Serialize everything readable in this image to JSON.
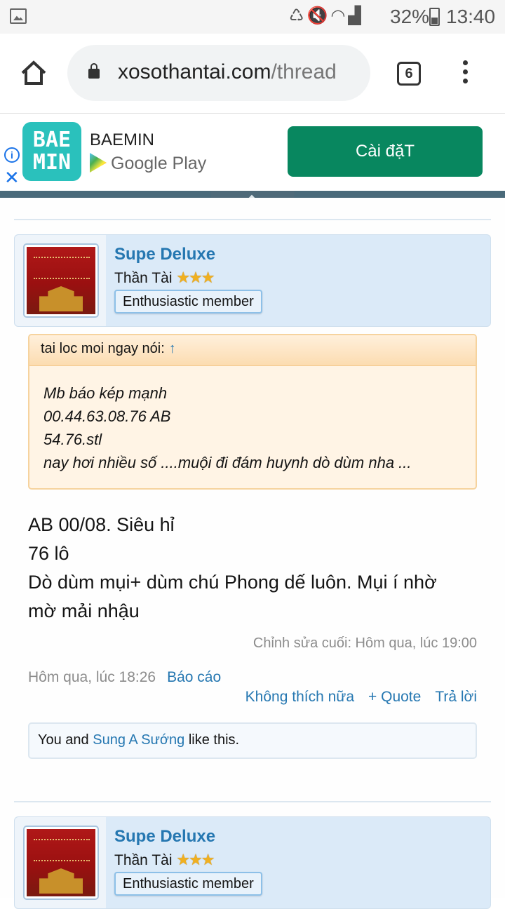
{
  "status_bar": {
    "battery": "32%",
    "time": "13:40"
  },
  "browser": {
    "url_domain": "xosothantai.com",
    "url_path": "/thread",
    "tab_count": "6"
  },
  "ad": {
    "logo_line1": "BAE",
    "logo_line2": "MIN",
    "brand": "BAEMIN",
    "store": "Google Play",
    "install_label": "Cài đặT",
    "info_glyph": "i",
    "close_glyph": "✕"
  },
  "posts": [
    {
      "username": "Supe Deluxe",
      "user_title": "Thần Tài",
      "stars": "★★★",
      "badge": "Enthusiastic member",
      "quote_author": "tai loc moi ngay nói:",
      "quote_arrow": "↑",
      "quote_lines": [
        "Mb báo kép mạnh",
        "00.44.63.08.76 AB",
        "54.76.stl",
        "nay hơi nhiều số ....muội đi đám huynh dò dùm nha ..."
      ],
      "body_lines": [
        "AB 00/08. Siêu hỉ",
        "76 lô",
        "Dò dùm mụi+ dùm chú Phong dế luôn. Mụi í nhờ",
        "mờ mải nhậu"
      ],
      "last_edited": "Chỉnh sửa cuối: Hôm qua, lúc 19:00",
      "timestamp": "Hôm qua, lúc 18:26",
      "report_label": "Báo cáo",
      "unlike_label": "Không thích nữa",
      "quote_label": "+ Quote",
      "reply_label": "Trả lời",
      "likes_prefix": "You and ",
      "likes_user": "Sung A Sướng",
      "likes_suffix": " like this."
    },
    {
      "username": "Supe Deluxe",
      "user_title": "Thần Tài",
      "stars": "★★★",
      "badge": "Enthusiastic member"
    }
  ]
}
